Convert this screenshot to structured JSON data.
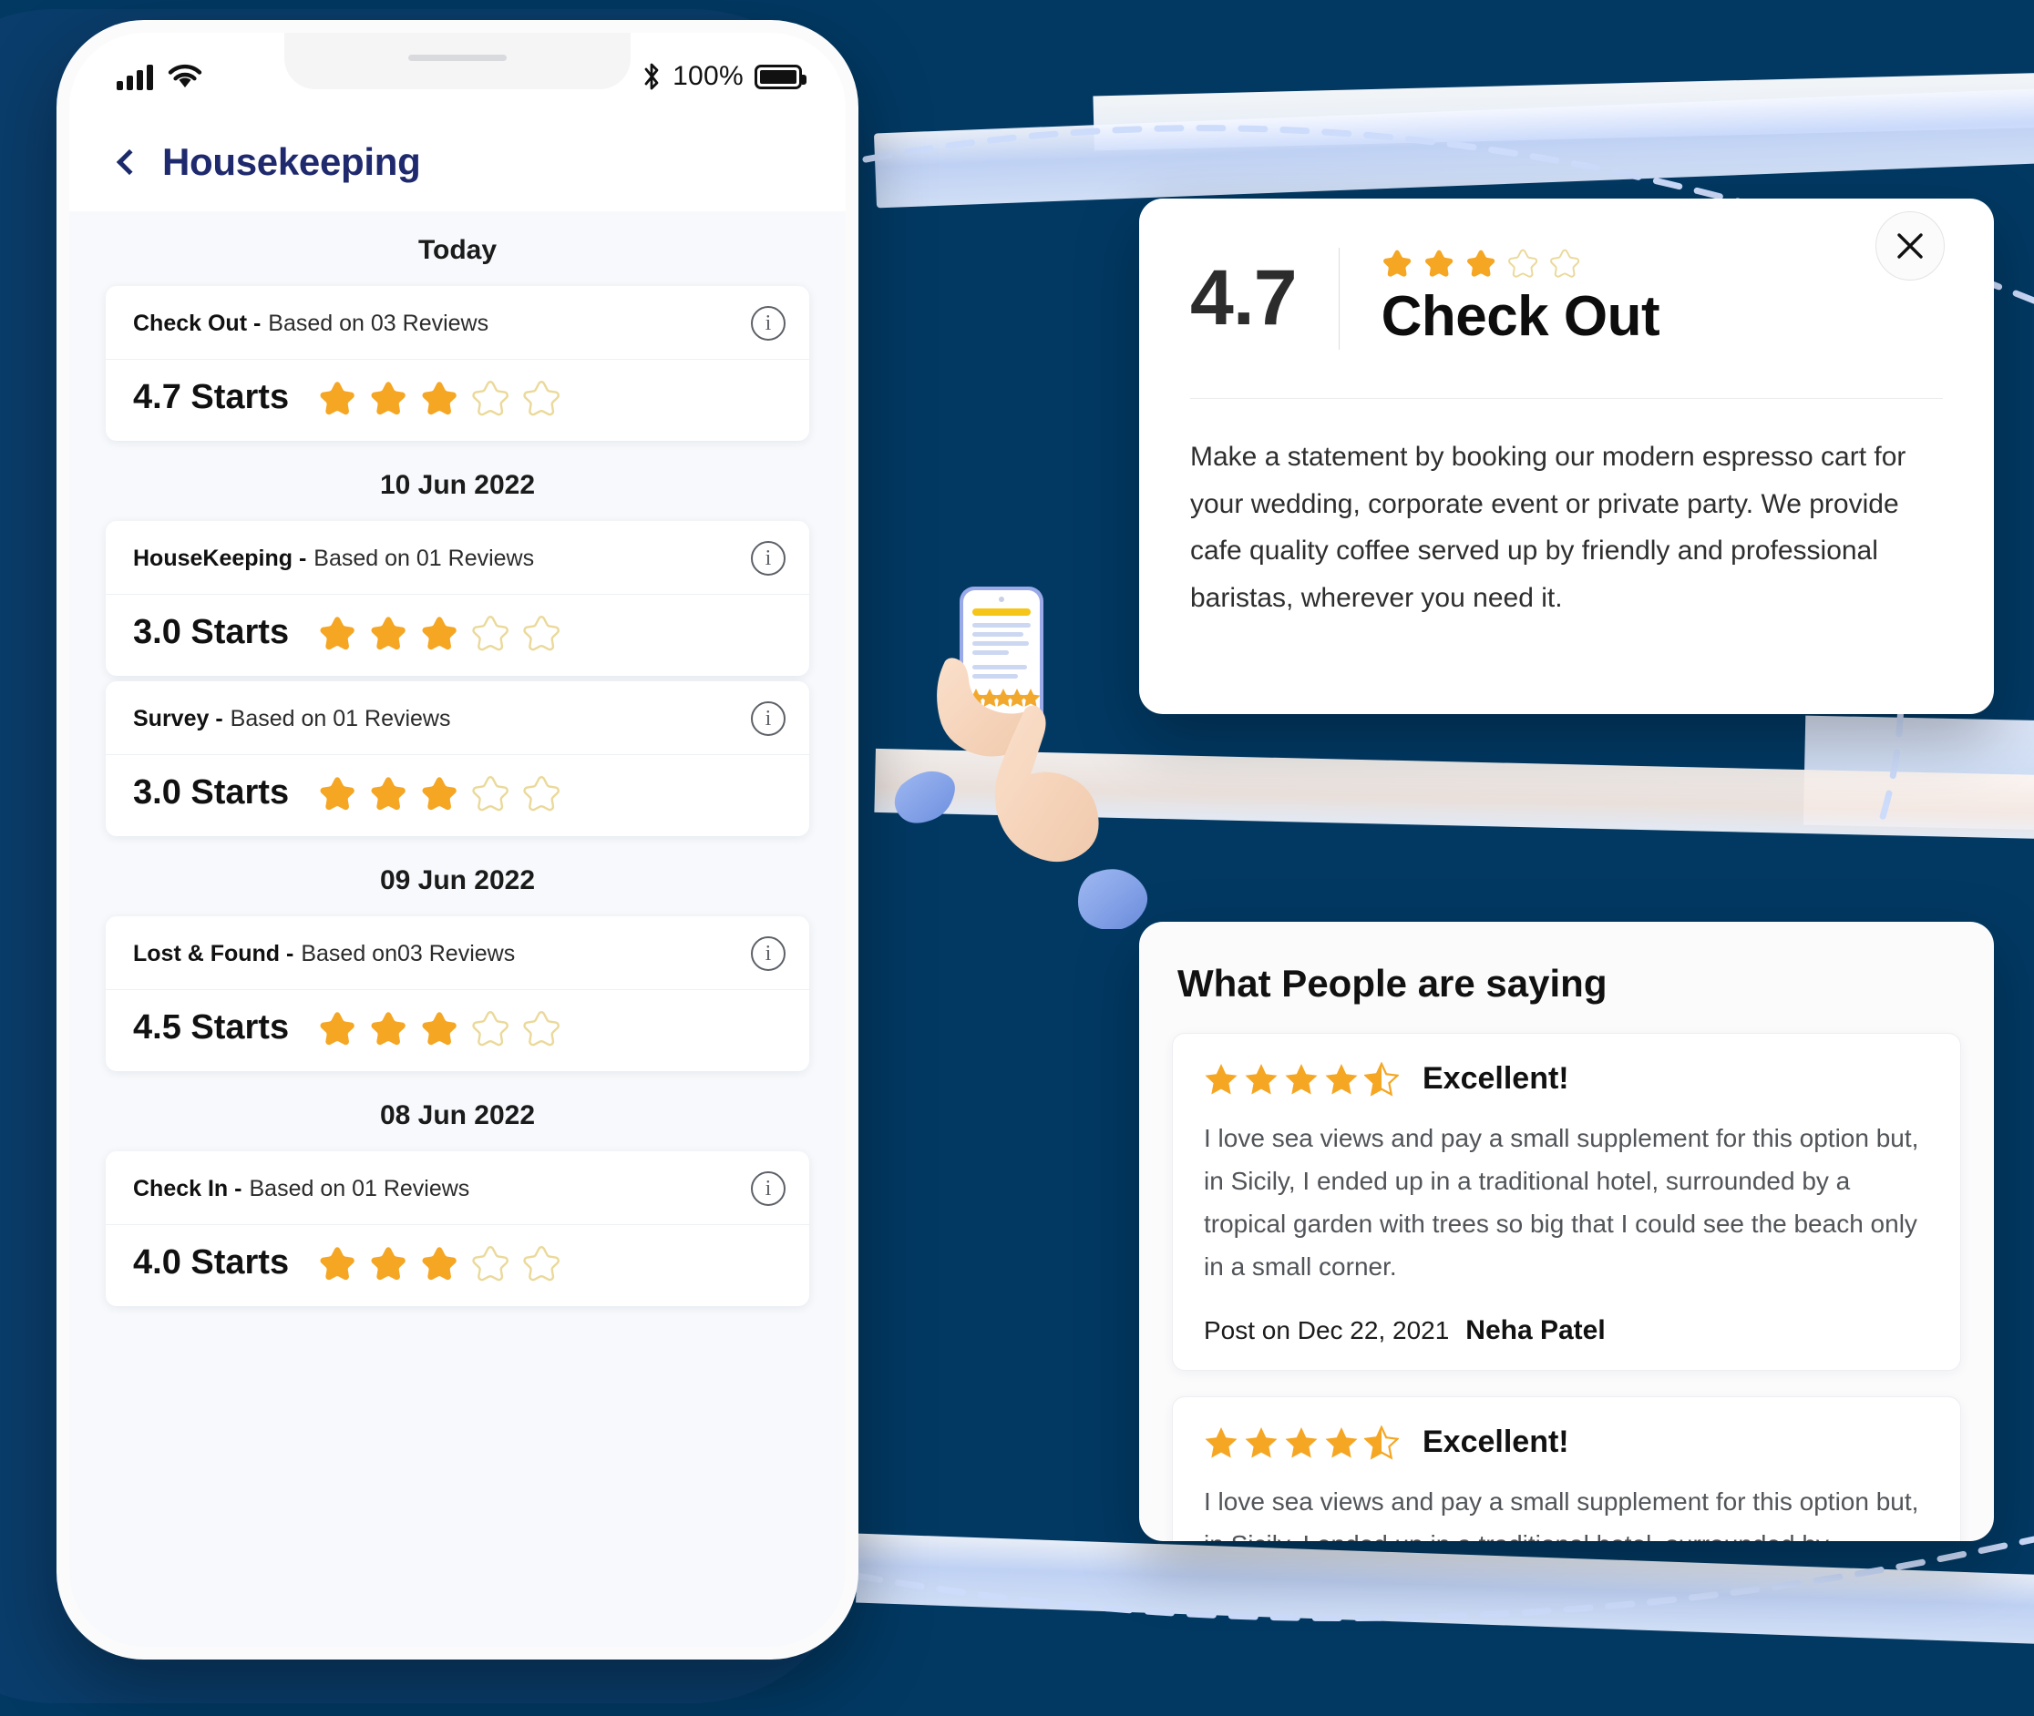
{
  "theme": {
    "background_navy": "#023963",
    "panel_navy": "#0a3d6b",
    "accent_star": "#F5A623",
    "star_empty_outline": "#EBD99A",
    "title_indigo": "#1F2A6E"
  },
  "phone": {
    "status_bar": {
      "signal_icon": "cellular-signal-icon",
      "wifi_icon": "wifi-icon",
      "bluetooth_icon": "bluetooth-icon",
      "battery_percent": "100%",
      "battery_icon": "battery-full-icon"
    },
    "appbar": {
      "back_icon": "chevron-left-icon",
      "title": "Housekeeping"
    },
    "groups": [
      {
        "date_label": "Today",
        "items": [
          {
            "name": "Check Out",
            "separator": "-",
            "reviews_text": "Based on 03 Reviews",
            "info_icon": "info-circle-icon",
            "score_text": "4.7 Starts",
            "score_value": 4.7,
            "stars_filled": 3,
            "stars_total": 5
          }
        ]
      },
      {
        "date_label": "10 Jun 2022",
        "items": [
          {
            "name": "HouseKeeping",
            "separator": "-",
            "reviews_text": "Based on 01 Reviews",
            "info_icon": "info-circle-icon",
            "score_text": "3.0 Starts",
            "score_value": 3.0,
            "stars_filled": 3,
            "stars_total": 5
          },
          {
            "name": "Survey",
            "separator": "-",
            "reviews_text": "Based on 01 Reviews",
            "info_icon": "info-circle-icon",
            "score_text": "3.0 Starts",
            "score_value": 3.0,
            "stars_filled": 3,
            "stars_total": 5
          }
        ]
      },
      {
        "date_label": "09 Jun 2022",
        "items": [
          {
            "name": "Lost & Found",
            "separator": "-",
            "reviews_text": "Based on03 Reviews",
            "info_icon": "info-circle-icon",
            "score_text": "4.5 Starts",
            "score_value": 4.5,
            "stars_filled": 3,
            "stars_total": 5
          }
        ]
      },
      {
        "date_label": "08 Jun 2022",
        "items": [
          {
            "name": "Check In",
            "separator": "-",
            "reviews_text": "Based on 01 Reviews",
            "info_icon": "info-circle-icon",
            "score_text": "4.0 Starts",
            "score_value": 4.0,
            "stars_filled": 3,
            "stars_total": 5
          }
        ]
      }
    ]
  },
  "detail_modal": {
    "score": "4.7",
    "stars_filled": 3,
    "stars_total": 5,
    "title": "Check Out",
    "close_icon": "close-x-icon",
    "description": "Make a statement by booking our modern espresso cart for your wedding, corporate event or private party. We provide cafe quality coffee served up by friendly and professional baristas, wherever you need it."
  },
  "reviews_panel": {
    "heading": "What People are saying",
    "cards": [
      {
        "stars_filled": 4,
        "stars_half": 1,
        "stars_total": 5,
        "verdict": "Excellent!",
        "body": "I love sea views and pay a small supplement for this option but, in Sicily, I ended up in a traditional hotel, surrounded by a tropical garden with trees so big that I could see the beach only in a small corner.",
        "posted_label": "Post on Dec 22, 2021",
        "author": "Neha Patel"
      },
      {
        "stars_filled": 4,
        "stars_half": 1,
        "stars_total": 5,
        "verdict": "Excellent!",
        "body": "I love sea views and pay a small supplement for this option but, in Sicily, I ended up in a traditional hotel, surrounded by"
      }
    ]
  },
  "illustration": {
    "name": "hands-holding-phone-rating-illustration",
    "phone_stars": 5
  }
}
